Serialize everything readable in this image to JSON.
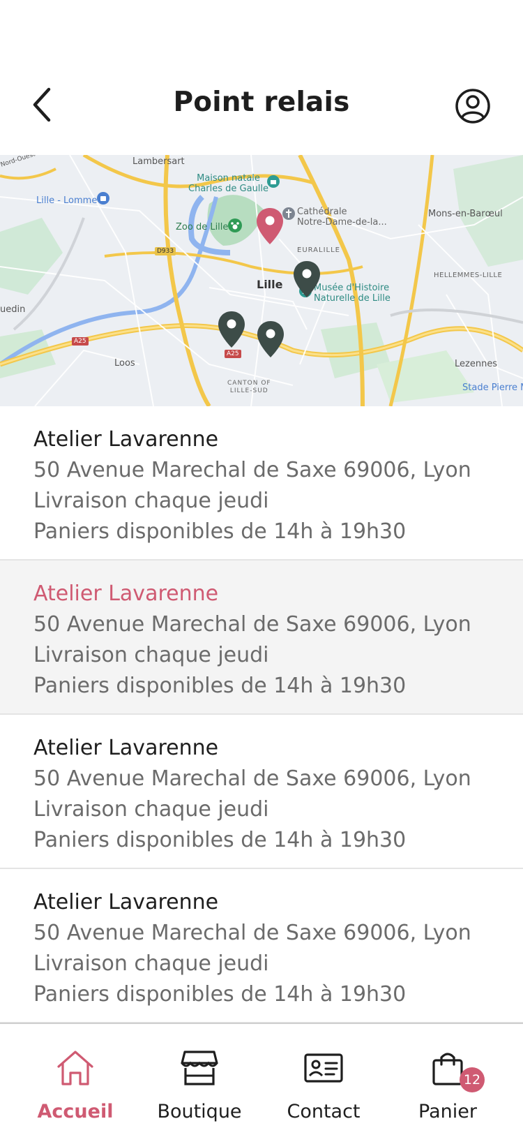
{
  "header": {
    "title": "Point relais",
    "back_icon": "chevron-left-icon",
    "profile_icon": "user-circle-icon"
  },
  "map": {
    "labels": {
      "lambersart": "Lambersart",
      "maison_natale": "Maison natale\nCharles de Gaulle",
      "lille_lomme": "Lille - Lomme",
      "cathedrale": "Cathédrale\nNotre-Dame-de-la...",
      "mons": "Mons-en-Barœul",
      "zoo": "Zoo de Lille",
      "euralille": "EURALILLE",
      "lille": "Lille",
      "hellemmes": "HELLEMMES-LILLE",
      "musee": "Musée d'Histoire\nNaturelle de Lille",
      "uedin": "uedin",
      "loos": "Loos",
      "lezennes": "Lezennes",
      "canton": "CANTON OF\nLILLE-SUD",
      "stade": "Stade Pierre M",
      "nord_ouest": "Nord-Ouest",
      "d933": "D933",
      "a25a": "A25",
      "a25b": "A25"
    },
    "colors": {
      "selected_marker": "#cf5a72",
      "marker": "#3d4c48"
    }
  },
  "relays": [
    {
      "name": "Atelier Lavarenne",
      "address": "50 Avenue Marechal de Saxe 69006, Lyon",
      "delivery": "Livraison chaque jeudi",
      "hours": "Paniers disponibles de 14h à 19h30",
      "selected": false
    },
    {
      "name": "Atelier Lavarenne",
      "address": "50 Avenue Marechal de Saxe 69006, Lyon",
      "delivery": "Livraison chaque jeudi",
      "hours": "Paniers disponibles de 14h à 19h30",
      "selected": true
    },
    {
      "name": "Atelier Lavarenne",
      "address": "50 Avenue Marechal de Saxe 69006, Lyon",
      "delivery": "Livraison chaque jeudi",
      "hours": "Paniers disponibles de 14h à 19h30",
      "selected": false
    },
    {
      "name": "Atelier Lavarenne",
      "address": "50 Avenue Marechal de Saxe 69006, Lyon",
      "delivery": "Livraison chaque jeudi",
      "hours": "Paniers disponibles de 14h à 19h30",
      "selected": false
    }
  ],
  "nav": {
    "items": [
      {
        "label": "Accueil",
        "icon": "home-icon",
        "active": true
      },
      {
        "label": "Boutique",
        "icon": "shop-icon",
        "active": false
      },
      {
        "label": "Contact",
        "icon": "contact-card-icon",
        "active": false
      },
      {
        "label": "Panier",
        "icon": "shopping-bag-icon",
        "active": false
      }
    ],
    "cart_count": "12"
  },
  "colors": {
    "accent": "#cf5a72",
    "text": "#1e1e1e",
    "muted_text": "#6b6b6b",
    "selected_bg": "#f4f4f4"
  }
}
